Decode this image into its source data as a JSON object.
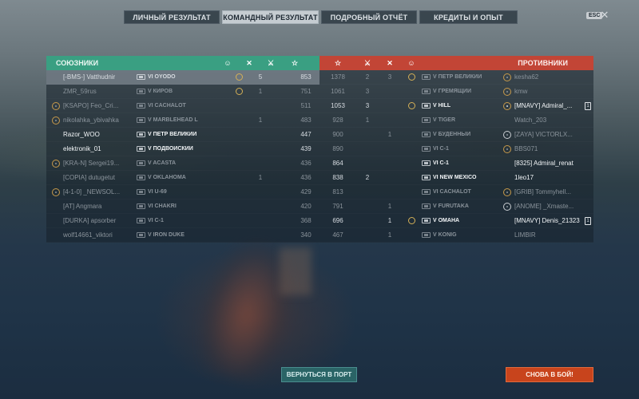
{
  "tabs": [
    {
      "label": "ЛИЧНЫЙ РЕЗУЛЬТАТ",
      "active": false
    },
    {
      "label": "КОМАНДНЫЙ РЕЗУЛЬТАТ",
      "active": true
    },
    {
      "label": "ПОДРОБНЫЙ ОТЧЁТ",
      "active": false
    },
    {
      "label": "КРЕДИТЫ И ОПЫТ",
      "active": false
    }
  ],
  "esc_label": "ESC",
  "close_glyph": "✕",
  "allies": {
    "title": "СОЮЗНИКИ",
    "header_icons": [
      "achievement-icon",
      "ribbon-icon",
      "kills-icon",
      "experience-icon"
    ],
    "header_glyphs": [
      "☺",
      "✕",
      "⚔",
      "☆"
    ],
    "rows": [
      {
        "badge": "",
        "player": "[-BMS-] Vatthudnir",
        "ship": "VI ÖYODO",
        "ach": true,
        "a": "",
        "b": "5",
        "score": "853",
        "state": "me"
      },
      {
        "badge": "",
        "player": "ZMR_59rus",
        "ship": "V КИРОВ",
        "ach": true,
        "a": "",
        "b": "1",
        "score": "751",
        "state": "dead"
      },
      {
        "badge": "o",
        "player": "[KSAPO] Feo_Cri...",
        "ship": "VI CACHALOT",
        "ach": false,
        "a": "",
        "b": "",
        "score": "511",
        "state": "dead"
      },
      {
        "badge": "o",
        "player": "nikolahka_ybivahka",
        "ship": "V MARBLEHEAD L",
        "ach": false,
        "a": "",
        "b": "1",
        "score": "483",
        "state": "dead"
      },
      {
        "badge": "",
        "player": "Razor_WOO",
        "ship": "V ПЁТР ВЕЛИКИЙ",
        "ach": false,
        "a": "",
        "b": "",
        "score": "447",
        "state": "alive"
      },
      {
        "badge": "",
        "player": "elektronik_01",
        "ship": "V ПОДВОЙСКИЙ",
        "ach": false,
        "a": "",
        "b": "",
        "score": "439",
        "state": "alive"
      },
      {
        "badge": "o",
        "player": "[KRA-N] Sergei19...",
        "ship": "V ACASTA",
        "ach": false,
        "a": "",
        "b": "",
        "score": "436",
        "state": "dead"
      },
      {
        "badge": "",
        "player": "[COPIA] dutugetut",
        "ship": "V OKLAHOMA",
        "ach": false,
        "a": "",
        "b": "1",
        "score": "436",
        "state": "dead"
      },
      {
        "badge": "o",
        "player": "[4-1-0] _NEWSOL...",
        "ship": "VI U-69",
        "ach": false,
        "a": "",
        "b": "",
        "score": "429",
        "state": "dead"
      },
      {
        "badge": "",
        "player": "[AT] Angmara",
        "ship": "VI CHAKRI",
        "ach": false,
        "a": "",
        "b": "",
        "score": "420",
        "state": "dead"
      },
      {
        "badge": "",
        "player": "[DURKA] apsorber",
        "ship": "VI C-1",
        "ach": false,
        "a": "",
        "b": "",
        "score": "368",
        "state": "dead"
      },
      {
        "badge": "",
        "player": "wolf14661_viktori",
        "ship": "V IRON DUKE",
        "ach": false,
        "a": "",
        "b": "",
        "score": "340",
        "state": "dead"
      }
    ]
  },
  "enemies": {
    "title": "ПРОТИВНИКИ",
    "header_glyphs": [
      "☆",
      "⚔",
      "✕",
      "☺"
    ],
    "rows": [
      {
        "score": "1378",
        "a": "2",
        "b": "3",
        "ach": true,
        "ship": "V ПЁТР ВЕЛИКИЙ",
        "badge": "o",
        "player": "kesha62",
        "div": "",
        "state": "dead"
      },
      {
        "score": "1061",
        "a": "3",
        "b": "",
        "ach": false,
        "ship": "V ГРЕМЯЩИЙ",
        "badge": "o",
        "player": "kmw",
        "div": "",
        "state": "dead"
      },
      {
        "score": "1053",
        "a": "3",
        "b": "",
        "ach": true,
        "ship": "V HILL",
        "badge": "o",
        "player": "[MNAVY] Admiral_...",
        "div": "1",
        "state": "alive"
      },
      {
        "score": "928",
        "a": "1",
        "b": "",
        "ach": false,
        "ship": "V TIGER",
        "badge": "",
        "player": "Watch_203",
        "div": "",
        "state": "dead"
      },
      {
        "score": "900",
        "a": "",
        "b": "1",
        "ach": false,
        "ship": "V БУДЁННЫЙ",
        "badge": "w",
        "player": "[ZAYA] VICTORLX...",
        "div": "",
        "state": "dead"
      },
      {
        "score": "890",
        "a": "",
        "b": "",
        "ach": false,
        "ship": "VI C-1",
        "badge": "o",
        "player": "BBS071",
        "div": "",
        "state": "dead"
      },
      {
        "score": "864",
        "a": "",
        "b": "",
        "ach": false,
        "ship": "VI C-1",
        "badge": "",
        "player": "[8325] Admiral_renat",
        "div": "",
        "state": "alive"
      },
      {
        "score": "838",
        "a": "2",
        "b": "",
        "ach": false,
        "ship": "VI NEW MEXICO",
        "badge": "",
        "player": "1leo17",
        "div": "",
        "state": "alive"
      },
      {
        "score": "813",
        "a": "",
        "b": "",
        "ach": false,
        "ship": "VI CACHALOT",
        "badge": "o",
        "player": "[GRIB] Tommyhell...",
        "div": "",
        "state": "dead"
      },
      {
        "score": "791",
        "a": "",
        "b": "1",
        "ach": false,
        "ship": "V FURUTAKA",
        "badge": "w",
        "player": "[ANOME] _Xmaste...",
        "div": "",
        "state": "dead"
      },
      {
        "score": "696",
        "a": "",
        "b": "1",
        "ach": true,
        "ship": "V OMAHA",
        "badge": "",
        "player": "[MNAVY] Denis_21323",
        "div": "1",
        "state": "alive"
      },
      {
        "score": "467",
        "a": "",
        "b": "1",
        "ach": false,
        "ship": "V KÖNIG",
        "badge": "",
        "player": "LIMBIR",
        "div": "",
        "state": "dead"
      }
    ]
  },
  "buttons": {
    "port": "ВЕРНУТЬСЯ В ПОРТ",
    "battle": "СНОВА В БОЙ!"
  },
  "colors": {
    "allies_header": "#3a9f82",
    "enemies_header": "#c24536",
    "battle_button": "#c8441c",
    "port_button": "#2a6466"
  }
}
